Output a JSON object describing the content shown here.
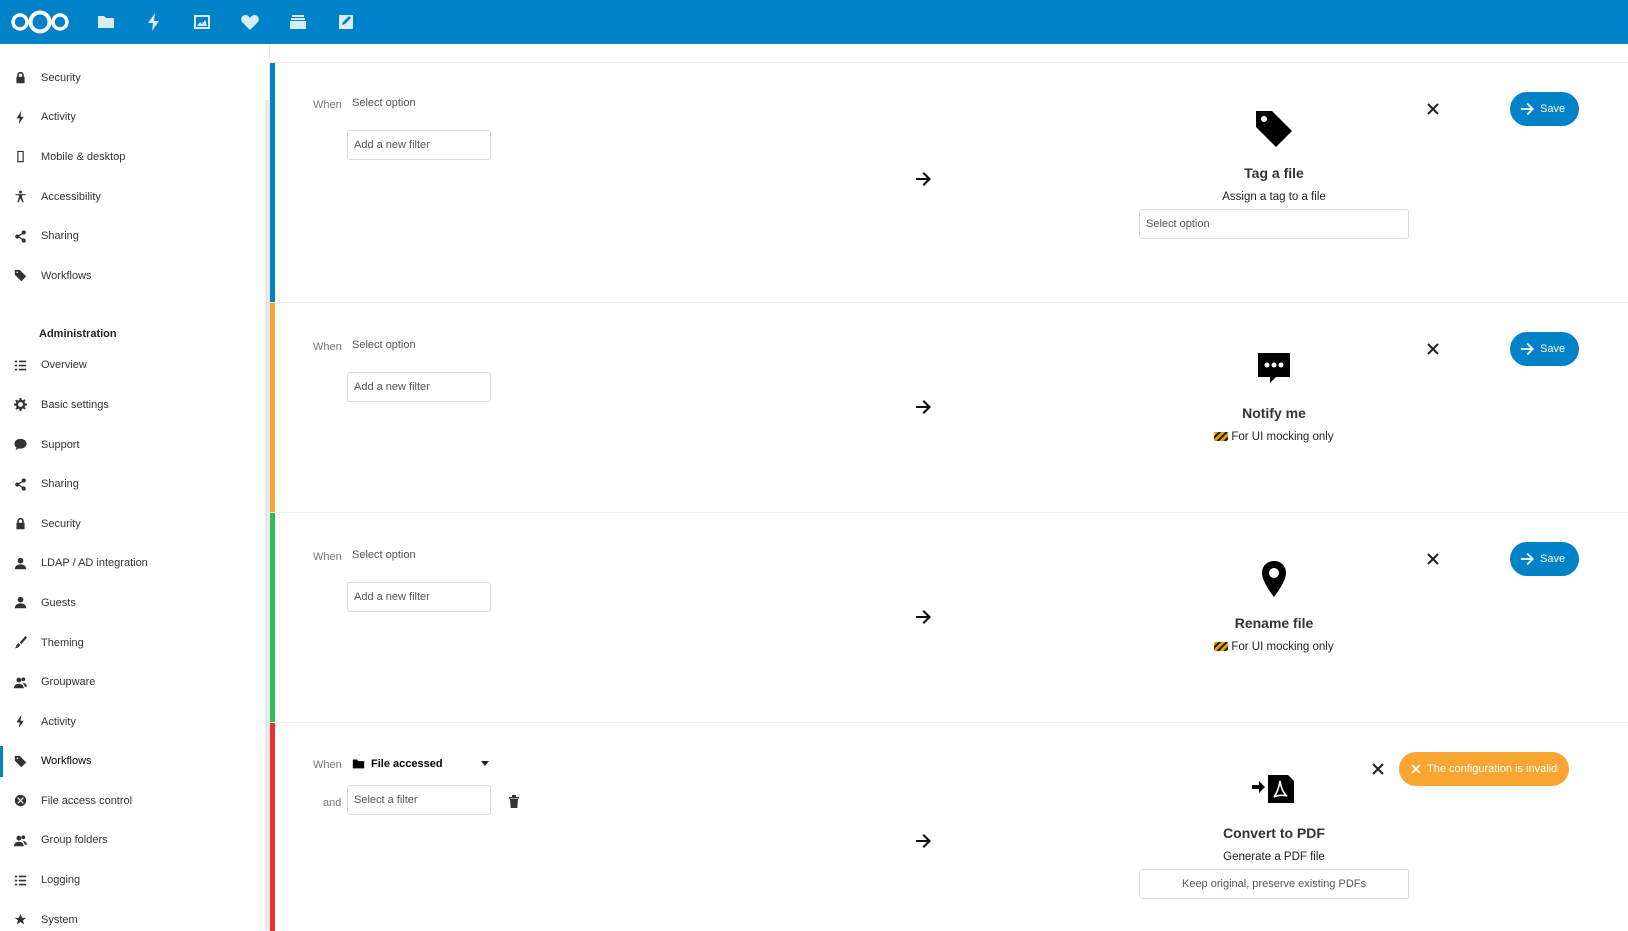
{
  "header": {
    "apps": [
      "files-icon",
      "activity-icon",
      "photos-icon",
      "favorites-icon",
      "deck-icon",
      "notes-icon"
    ]
  },
  "sidebar": {
    "personal_items": [
      {
        "label": "Security",
        "icon": "lock-icon"
      },
      {
        "label": "Activity",
        "icon": "flash-icon"
      },
      {
        "label": "Mobile & desktop",
        "icon": "phone-icon"
      },
      {
        "label": "Accessibility",
        "icon": "accessibility-icon"
      },
      {
        "label": "Sharing",
        "icon": "share-icon"
      },
      {
        "label": "Workflows",
        "icon": "tag-icon"
      }
    ],
    "admin_heading": "Administration",
    "admin_items": [
      {
        "label": "Overview",
        "icon": "list-icon"
      },
      {
        "label": "Basic settings",
        "icon": "gear-icon"
      },
      {
        "label": "Support",
        "icon": "comment-icon"
      },
      {
        "label": "Sharing",
        "icon": "share-icon"
      },
      {
        "label": "Security",
        "icon": "lock-icon"
      },
      {
        "label": "LDAP / AD integration",
        "icon": "user-icon"
      },
      {
        "label": "Guests",
        "icon": "user-icon"
      },
      {
        "label": "Theming",
        "icon": "brush-icon"
      },
      {
        "label": "Groupware",
        "icon": "group-icon"
      },
      {
        "label": "Activity",
        "icon": "flash-icon"
      },
      {
        "label": "Workflows",
        "icon": "tag-icon",
        "active": true
      },
      {
        "label": "File access control",
        "icon": "block-icon"
      },
      {
        "label": "Group folders",
        "icon": "group-icon"
      },
      {
        "label": "Logging",
        "icon": "list-icon"
      },
      {
        "label": "System",
        "icon": "system-icon"
      }
    ]
  },
  "rules": [
    {
      "color": "#0082c9",
      "when_label": "When",
      "event": "Select option",
      "filter_placeholder": "Add a new filter",
      "operation": {
        "icon": "tag-icon",
        "title": "Tag a file",
        "description": "Assign a tag to a file",
        "input": "Select option"
      },
      "action_label": "Save"
    },
    {
      "color": "#f9a531",
      "when_label": "When",
      "event": "Select option",
      "filter_placeholder": "Add a new filter",
      "operation": {
        "icon": "notify-icon",
        "title": "Notify me",
        "description": "For UI mocking only"
      },
      "action_label": "Save"
    },
    {
      "color": "#2ebd59",
      "when_label": "When",
      "event": "Select option",
      "filter_placeholder": "Add a new filter",
      "operation": {
        "icon": "location-icon",
        "title": "Rename file",
        "description": "For UI mocking only"
      },
      "action_label": "Save"
    },
    {
      "color": "#e9322d",
      "when_label": "When",
      "event": "File accessed",
      "and_label": "and",
      "filter_placeholder": "Select a filter",
      "operation": {
        "icon": "convert-pdf-icon",
        "title": "Convert to PDF",
        "description": "Generate a PDF file",
        "input": "Keep original, preserve existing PDFs"
      },
      "action_label": "The configuration is invalid"
    }
  ]
}
